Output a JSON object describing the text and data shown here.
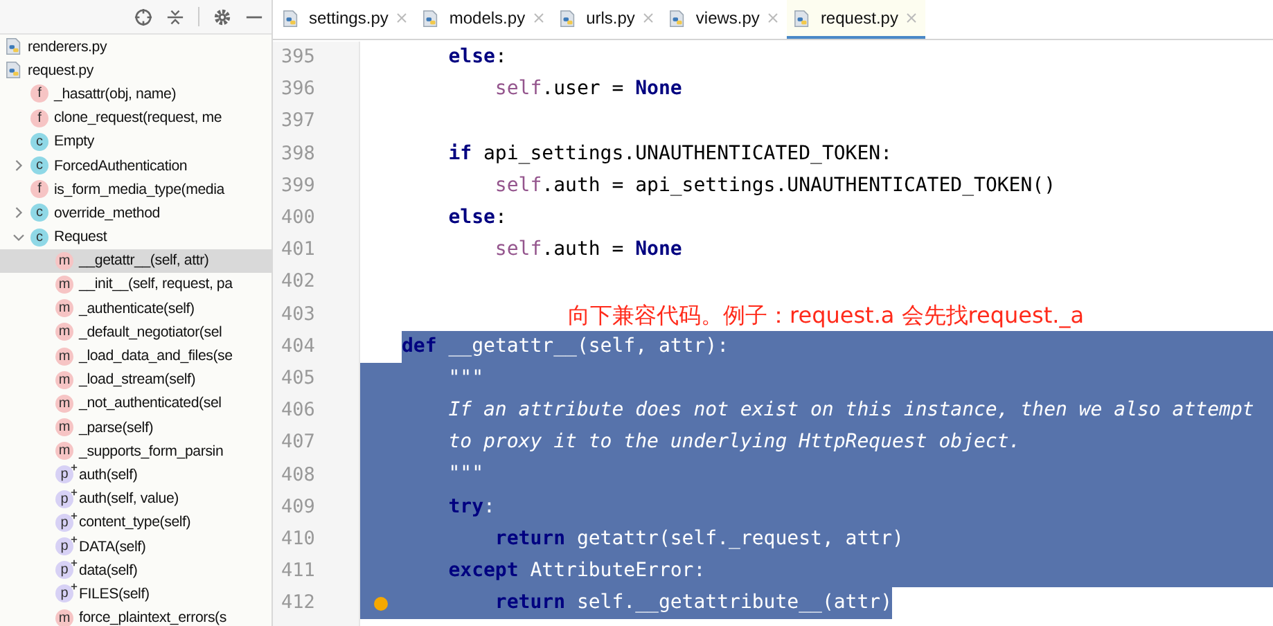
{
  "tool_window": {
    "items": [
      {
        "label": "renderers.py",
        "kind": "file"
      },
      {
        "label": "request.py",
        "kind": "file",
        "children": [
          {
            "label": "_hasattr(obj, name)",
            "kind": "function",
            "badge": "f"
          },
          {
            "label": "clone_request(request, me",
            "kind": "function",
            "badge": "f"
          },
          {
            "label": "Empty",
            "kind": "class",
            "badge": "c"
          },
          {
            "label": "ForcedAuthentication",
            "kind": "class",
            "badge": "c",
            "expanded": false
          },
          {
            "label": "is_form_media_type(media",
            "kind": "function",
            "badge": "f"
          },
          {
            "label": "override_method",
            "kind": "class",
            "badge": "c",
            "expanded": false
          },
          {
            "label": "Request",
            "kind": "class",
            "badge": "c",
            "expanded": true,
            "children": [
              {
                "label": "__getattr__(self, attr)",
                "kind": "method",
                "badge": "m",
                "selected": true
              },
              {
                "label": "__init__(self, request, pa",
                "kind": "method",
                "badge": "m",
                "selected": false
              },
              {
                "label": "_authenticate(self)",
                "kind": "method",
                "badge": "m",
                "selected": false
              },
              {
                "label": "_default_negotiator(sel",
                "kind": "method",
                "badge": "m",
                "selected": false
              },
              {
                "label": "_load_data_and_files(se",
                "kind": "method",
                "badge": "m",
                "selected": false
              },
              {
                "label": "_load_stream(self)",
                "kind": "method",
                "badge": "m",
                "selected": false
              },
              {
                "label": "_not_authenticated(sel",
                "kind": "method",
                "badge": "m",
                "selected": false
              },
              {
                "label": "_parse(self)",
                "kind": "method",
                "badge": "m",
                "selected": false
              },
              {
                "label": "_supports_form_parsin",
                "kind": "method",
                "badge": "m",
                "selected": false
              },
              {
                "label": "auth(self)",
                "kind": "property",
                "badge": "p",
                "selected": false
              },
              {
                "label": "auth(self, value)",
                "kind": "property",
                "badge": "p",
                "selected": false
              },
              {
                "label": "content_type(self)",
                "kind": "property",
                "badge": "p",
                "selected": false
              },
              {
                "label": "DATA(self)",
                "kind": "property",
                "badge": "p",
                "selected": false
              },
              {
                "label": "data(self)",
                "kind": "property",
                "badge": "p",
                "selected": false
              },
              {
                "label": "FILES(self)",
                "kind": "property",
                "badge": "p",
                "selected": false
              },
              {
                "label": "force_plaintext_errors(s",
                "kind": "method",
                "badge": "m",
                "selected": false
              }
            ]
          }
        ]
      }
    ]
  },
  "tabs": [
    {
      "label": "settings.py",
      "selected": false
    },
    {
      "label": "models.py",
      "selected": false
    },
    {
      "label": "urls.py",
      "selected": false
    },
    {
      "label": "views.py",
      "selected": false
    },
    {
      "label": "request.py",
      "selected": true
    }
  ],
  "note": "向下兼容代码。例子：request.a  会先找request._a",
  "lines": [
    {
      "number": "395",
      "selected": false,
      "bookmark": false,
      "tokens": [
        {
          "kind": "keyword",
          "text": "    else"
        },
        {
          "kind": "plain",
          "text": ":"
        }
      ]
    },
    {
      "number": "396",
      "selected": false,
      "bookmark": false,
      "tokens": [
        {
          "kind": "self",
          "text": "        self"
        },
        {
          "kind": "plain",
          "text": ".user = "
        },
        {
          "kind": "keyword",
          "text": "None"
        }
      ]
    },
    {
      "number": "397",
      "selected": false,
      "bookmark": false
    },
    {
      "number": "398",
      "selected": false,
      "bookmark": false,
      "tokens": [
        {
          "kind": "keyword",
          "text": "    if"
        },
        {
          "kind": "plain",
          "text": " api_settings.UNAUTHENTICATED_TOKEN:"
        }
      ]
    },
    {
      "number": "399",
      "selected": false,
      "bookmark": false,
      "tokens": [
        {
          "kind": "self",
          "text": "        self"
        },
        {
          "kind": "plain",
          "text": ".auth = api_settings.UNAUTHENTICATED_TOKEN()"
        }
      ]
    },
    {
      "number": "400",
      "selected": false,
      "bookmark": false,
      "tokens": [
        {
          "kind": "keyword",
          "text": "    else"
        },
        {
          "kind": "plain",
          "text": ":"
        }
      ]
    },
    {
      "number": "401",
      "selected": false,
      "bookmark": false,
      "tokens": [
        {
          "kind": "self",
          "text": "        self"
        },
        {
          "kind": "plain",
          "text": ".auth = "
        },
        {
          "kind": "keyword",
          "text": "None"
        }
      ]
    },
    {
      "number": "402",
      "selected": false,
      "bookmark": false
    },
    {
      "number": "403",
      "selected": false,
      "bookmark": false,
      "note": true
    },
    {
      "number": "404",
      "selected": true,
      "bookmark": false,
      "tokens": [
        {
          "kind": "keyword",
          "text": "def"
        },
        {
          "kind": "plain",
          "text": " __getattr__(self, attr):"
        }
      ]
    },
    {
      "number": "405",
      "selected": true,
      "bookmark": false,
      "tokens": [
        {
          "kind": "doc",
          "text": "    \"\"\""
        }
      ]
    },
    {
      "number": "406",
      "selected": true,
      "bookmark": false,
      "tokens": [
        {
          "kind": "doc",
          "text": "    If an attribute does not exist on this instance, then we also attempt"
        }
      ]
    },
    {
      "number": "407",
      "selected": true,
      "bookmark": false,
      "tokens": [
        {
          "kind": "doc",
          "text": "    to proxy it to the underlying HttpRequest object."
        }
      ]
    },
    {
      "number": "408",
      "selected": true,
      "bookmark": false,
      "tokens": [
        {
          "kind": "doc",
          "text": "    \"\"\""
        }
      ]
    },
    {
      "number": "409",
      "selected": true,
      "bookmark": false,
      "tokens": [
        {
          "kind": "keyword",
          "text": "    try"
        },
        {
          "kind": "plain",
          "text": ":"
        }
      ]
    },
    {
      "number": "410",
      "selected": true,
      "bookmark": false,
      "tokens": [
        {
          "kind": "keyword",
          "text": "        return"
        },
        {
          "kind": "plain",
          "text": " getattr(self._request, attr)"
        }
      ]
    },
    {
      "number": "411",
      "selected": true,
      "bookmark": false,
      "tokens": [
        {
          "kind": "keyword",
          "text": "    except"
        },
        {
          "kind": "plain",
          "text": " AttributeError:"
        }
      ]
    },
    {
      "number": "412",
      "selected": true,
      "bookmark": true,
      "tokens": [
        {
          "kind": "keyword",
          "text": "        return"
        },
        {
          "kind": "plain",
          "text": " self.__getattribute__(attr)"
        }
      ]
    }
  ]
}
